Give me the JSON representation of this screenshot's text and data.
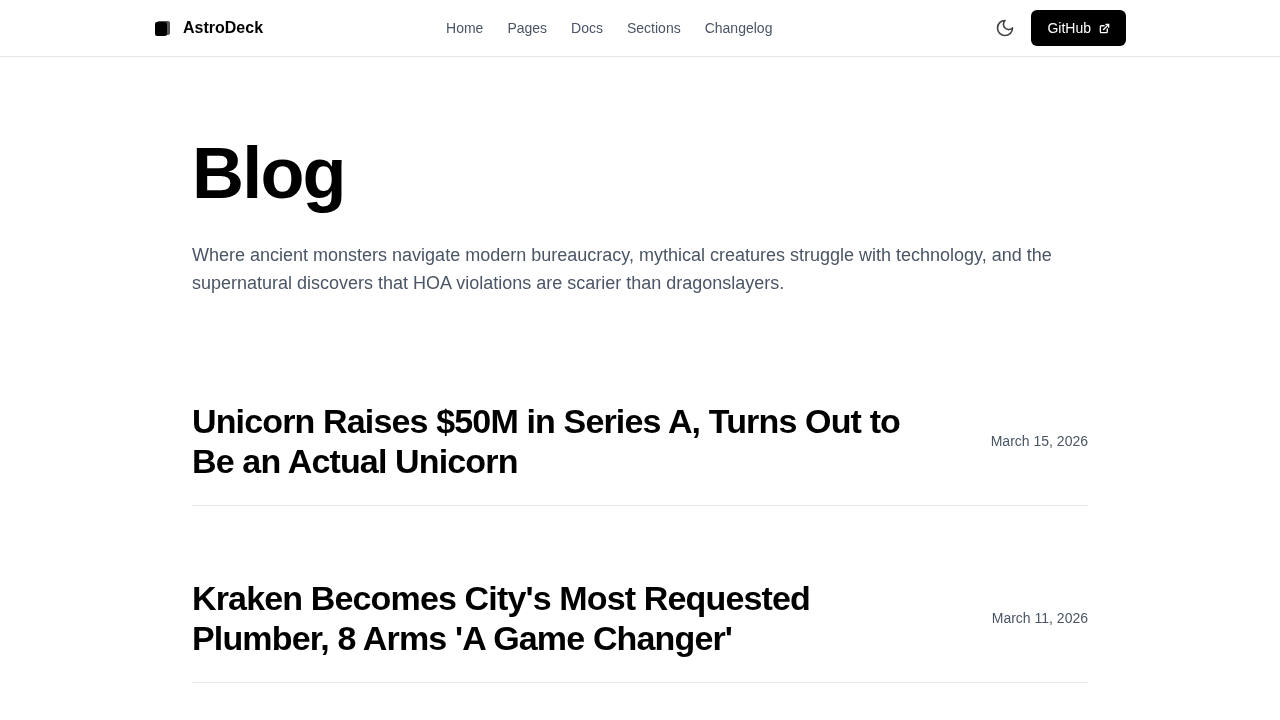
{
  "header": {
    "brand": "AstroDeck",
    "nav": [
      "Home",
      "Pages",
      "Docs",
      "Sections",
      "Changelog"
    ],
    "github_button": "GitHub"
  },
  "page": {
    "title": "Blog",
    "intro": "Where ancient monsters navigate modern bureaucracy, mythical creatures struggle with technology, and the supernatural discovers that HOA violations are scarier than dragonslayers."
  },
  "posts": [
    {
      "title": "Unicorn Raises $50M in Series A, Turns Out to Be an Actual Unicorn",
      "date": "March 15, 2026"
    },
    {
      "title": "Kraken Becomes City's Most Requested Plumber, 8 Arms 'A Game Changer'",
      "date": "March 11, 2026"
    }
  ]
}
